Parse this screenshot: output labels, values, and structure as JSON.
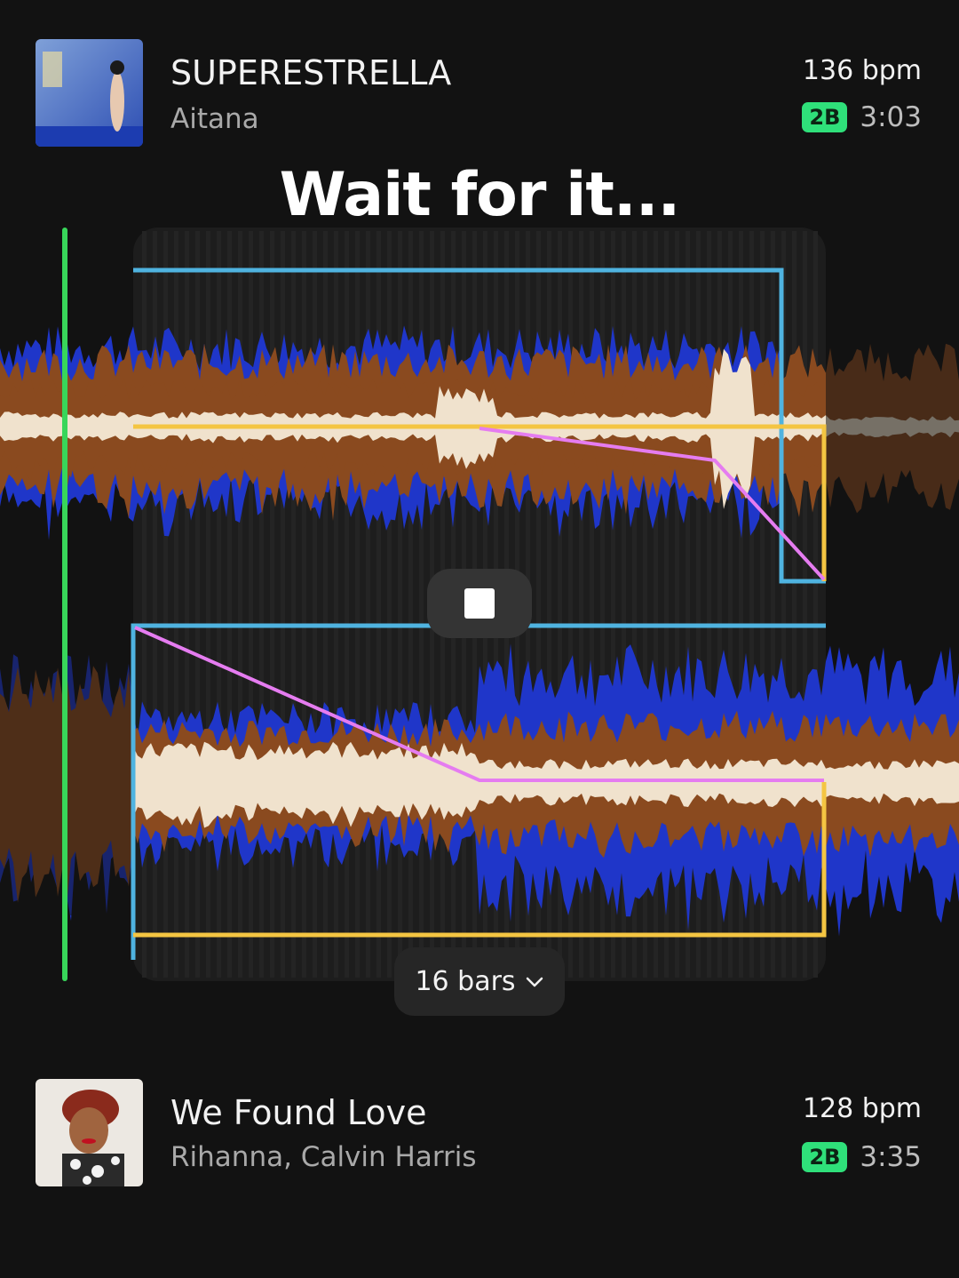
{
  "now_playing": {
    "title": "SUPERESTRELLA",
    "artist": "Aitana",
    "bpm": "136 bpm",
    "key": "2B",
    "duration": "3:03"
  },
  "status_message": "Wait for it...",
  "transition": {
    "length_label": "16 bars",
    "length_icon": "chevron-down-icon",
    "control_icon": "stop-icon"
  },
  "up_next": {
    "title": "We Found Love",
    "artist": "Rihanna, Calvin Harris",
    "bpm": "128 bpm",
    "key": "2B",
    "duration": "3:35"
  },
  "colors": {
    "background": "#121212",
    "key_badge": "#2fe07a",
    "playhead": "#38d65a",
    "volume_automation": "#f4c542",
    "eq_automation": "#e57cf0",
    "region_outline": "#4fb3e0",
    "wave_bass": "#1f36c9",
    "wave_mid": "#8a4a1f",
    "wave_high": "#f0e2cd"
  }
}
